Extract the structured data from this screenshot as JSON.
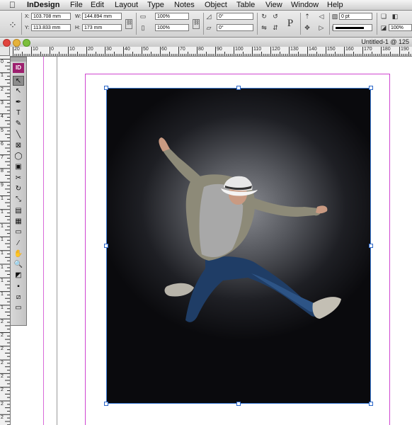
{
  "menubar": {
    "app_name": "InDesign",
    "items": [
      "File",
      "Edit",
      "Layout",
      "Type",
      "Notes",
      "Object",
      "Table",
      "View",
      "Window",
      "Help"
    ]
  },
  "control_panel": {
    "x_label": "X:",
    "x_value": "103.708 mm",
    "y_label": "Y:",
    "y_value": "113.833 mm",
    "w_label": "W:",
    "w_value": "144.894 mm",
    "h_label": "H:",
    "h_value": "173 mm",
    "scale_x": "100%",
    "scale_y": "100%",
    "rotate": "0°",
    "shear": "0°",
    "stroke_weight": "0 pt",
    "opacity": "100%",
    "reference_glyph": "P"
  },
  "window": {
    "title": "Untitled-1 @ 125"
  },
  "ruler": {
    "top": [
      "20",
      "10",
      "0",
      "10",
      "20",
      "30",
      "40",
      "50",
      "60",
      "70",
      "80",
      "90",
      "100",
      "110",
      "120",
      "130",
      "140",
      "150",
      "160",
      "170",
      "180",
      "190"
    ],
    "left": [
      "0",
      "1",
      "2",
      "3",
      "4",
      "5",
      "6",
      "7",
      "8",
      "9",
      "1",
      "1",
      "1",
      "1",
      "1",
      "1",
      "1",
      "1",
      "1",
      "2",
      "2",
      "2",
      "2",
      "2",
      "2",
      "2",
      "2"
    ]
  },
  "tools": {
    "logo": "ID",
    "items": [
      {
        "name": "selection-tool-icon",
        "glyph": "↖"
      },
      {
        "name": "direct-selection-tool-icon",
        "glyph": "↖"
      },
      {
        "name": "pen-tool-icon",
        "glyph": "✒"
      },
      {
        "name": "type-tool-icon",
        "glyph": "T"
      },
      {
        "name": "pencil-tool-icon",
        "glyph": "✎"
      },
      {
        "name": "line-tool-icon",
        "glyph": "╲"
      },
      {
        "name": "rectangle-frame-tool-icon",
        "glyph": "⊠"
      },
      {
        "name": "ellipse-tool-icon",
        "glyph": "◯"
      },
      {
        "name": "button-tool-icon",
        "glyph": "▣"
      },
      {
        "name": "scissors-tool-icon",
        "glyph": "✂"
      },
      {
        "name": "rotate-tool-icon",
        "glyph": "↻"
      },
      {
        "name": "scale-tool-icon",
        "glyph": "⤡"
      },
      {
        "name": "gradient-tool-icon",
        "glyph": "▤"
      },
      {
        "name": "gradient-feather-tool-icon",
        "glyph": "▦"
      },
      {
        "name": "note-tool-icon",
        "glyph": "▭"
      },
      {
        "name": "eyedropper-tool-icon",
        "glyph": "⁄"
      },
      {
        "name": "hand-tool-icon",
        "glyph": "✋"
      },
      {
        "name": "zoom-tool-icon",
        "glyph": "🔍"
      },
      {
        "name": "fill-stroke-icon",
        "glyph": "◩"
      },
      {
        "name": "formatting-affects-icon",
        "glyph": "▪"
      },
      {
        "name": "apply-none-icon",
        "glyph": "⧄"
      },
      {
        "name": "view-mode-icon",
        "glyph": "▭"
      }
    ]
  },
  "colors": {
    "margin_guide": "#cf45d0",
    "frame_selection": "#3a7ad6",
    "indesign_brand": "#9d1f6e"
  }
}
